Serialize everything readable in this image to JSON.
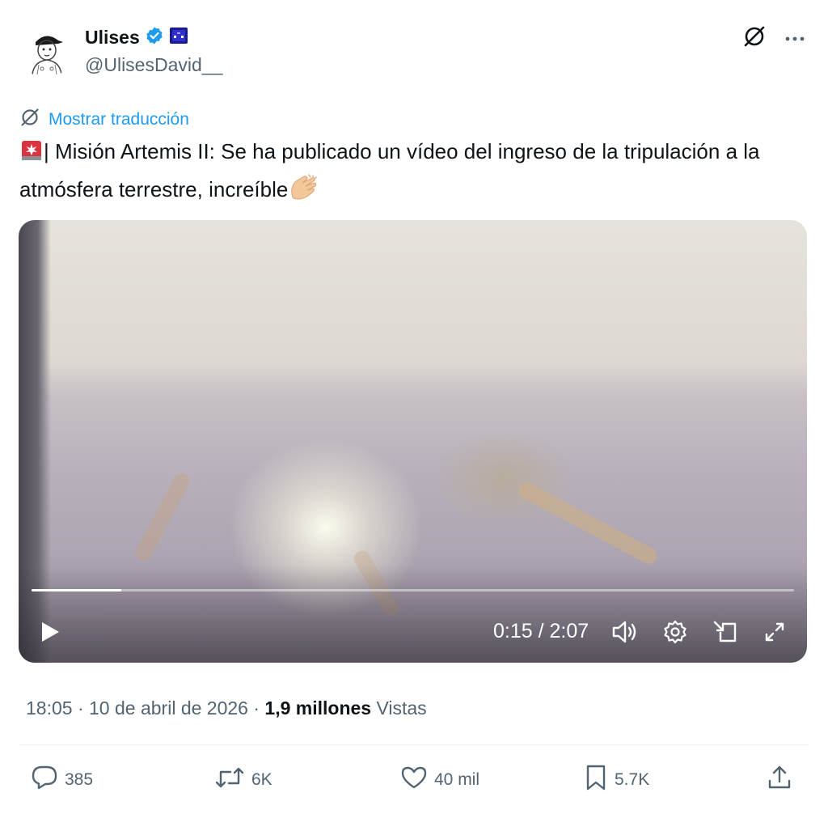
{
  "author": {
    "display_name": "Ulises",
    "handle": "@UlisesDavid__",
    "verified": true
  },
  "header": {
    "more_icon": "more-horizontal-icon",
    "grok_icon": "grok-icon"
  },
  "translation": {
    "link_label": "Mostrar traducción"
  },
  "tweet": {
    "text_line": "| Misión Artemis II: Se ha publicado un vídeo del ingreso de la tripulación a la atmósfera terrestre, increíble",
    "leading_emoji": "rotating-light-emoji",
    "trailing_emoji": "clapping-hands-emoji"
  },
  "video": {
    "time_label": "0:15 / 2:07",
    "progress": 0.118,
    "controls": [
      "play-icon",
      "volume-icon",
      "settings-icon",
      "pip-icon",
      "fullscreen-icon"
    ]
  },
  "meta": {
    "time": "18:05",
    "date": "10 de abril de 2026",
    "views_count": "1,9 millones",
    "views_label": "Vistas",
    "separator": "·"
  },
  "actions": {
    "replies": "385",
    "reposts": "6K",
    "likes": "40 mil",
    "bookmarks": "5.7K"
  },
  "colors": {
    "accent": "#1d9bf0",
    "secondary_text": "#536471",
    "primary_text": "#0f1419"
  }
}
